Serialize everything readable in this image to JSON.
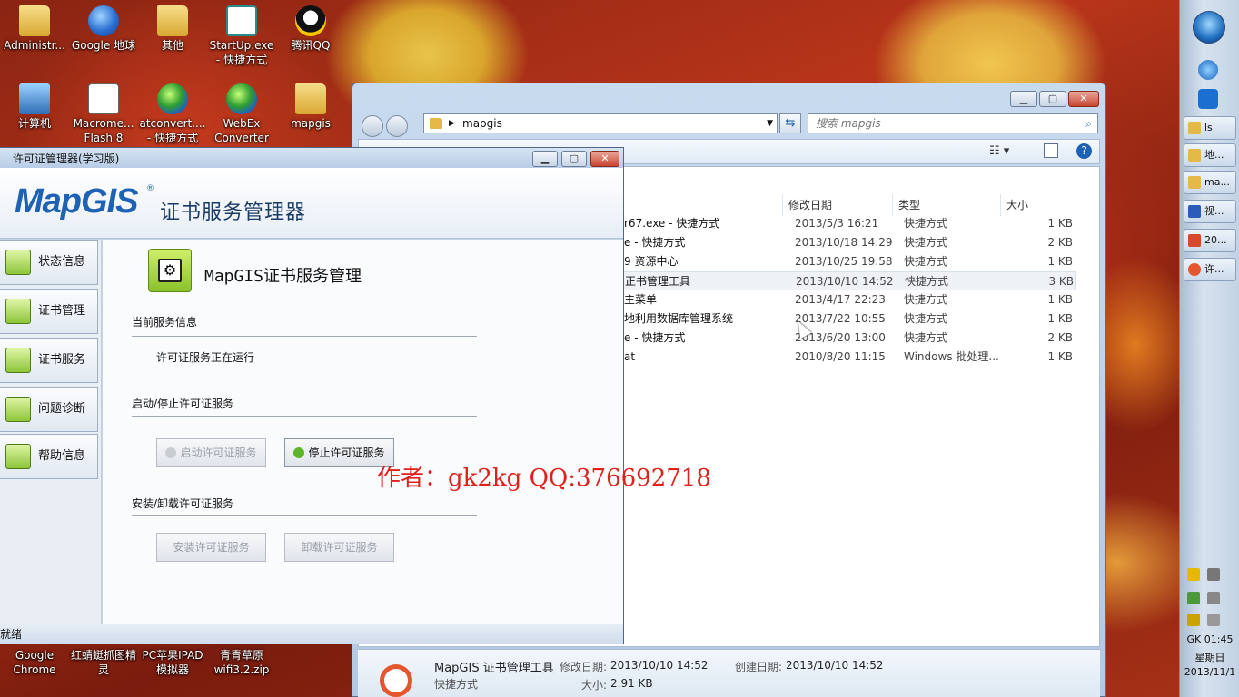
{
  "desktop": {
    "icons": [
      {
        "label": "Administr...",
        "icon": "folder-icon"
      },
      {
        "label": "Google 地球",
        "icon": "google-earth-icon"
      },
      {
        "label": "其他",
        "icon": "folder-icon"
      },
      {
        "label": "StartUp.exe - 快捷方式",
        "icon": "startup-icon"
      },
      {
        "label": "腾讯QQ",
        "icon": "qq-icon"
      },
      {
        "label": "计算机",
        "icon": "computer-icon"
      },
      {
        "label": "Macrome... Flash 8",
        "icon": "flash-doc-icon"
      },
      {
        "label": "atconvert.... - 快捷方式",
        "icon": "globe-icon"
      },
      {
        "label": "WebEx Converter",
        "icon": "globe-icon"
      },
      {
        "label": "mapgis",
        "icon": "folder-icon"
      },
      {
        "label": "Google Chrome",
        "icon": "chrome-icon"
      },
      {
        "label": "红蜻蜓抓图精灵",
        "icon": "dragonfly-icon"
      },
      {
        "label": "PC苹果IPAD 模拟器",
        "icon": "ipad-icon"
      },
      {
        "label": "青青草原 wifi3.2.zip",
        "icon": "zip-icon"
      }
    ]
  },
  "taskbar": {
    "buttons": [
      {
        "label": "ls",
        "icon": "folder-icon"
      },
      {
        "label": "地...",
        "icon": "folder-icon"
      },
      {
        "label": "ma...",
        "icon": "folder-icon"
      },
      {
        "label": "视...",
        "icon": "word-icon"
      },
      {
        "label": "20...",
        "icon": "calendar-icon"
      },
      {
        "label": "许...",
        "icon": "mapgis-icon"
      }
    ],
    "clock": {
      "time": "GK 01:45",
      "day": "星期日",
      "date": "2013/11/1"
    }
  },
  "explorer": {
    "address": "mapgis",
    "search_placeholder": "搜索 mapgis",
    "columns": {
      "date": "修改日期",
      "type": "类型",
      "size": "大小"
    },
    "files": [
      {
        "name": "r67.exe - 快捷方式",
        "date": "2013/5/3 16:21",
        "type": "快捷方式",
        "size": "1 KB"
      },
      {
        "name": "e - 快捷方式",
        "date": "2013/10/18 14:29",
        "type": "快捷方式",
        "size": "2 KB"
      },
      {
        "name": "9 资源中心",
        "date": "2013/10/25 19:58",
        "type": "快捷方式",
        "size": "1 KB"
      },
      {
        "name": "正书管理工具",
        "date": "2013/10/10 14:52",
        "type": "快捷方式",
        "size": "3 KB"
      },
      {
        "name": "主菜单",
        "date": "2013/4/17 22:23",
        "type": "快捷方式",
        "size": "1 KB"
      },
      {
        "name": "地利用数据库管理系统",
        "date": "2013/7/22 10:55",
        "type": "快捷方式",
        "size": "1 KB"
      },
      {
        "name": "e - 快捷方式",
        "date": "2013/6/20 13:00",
        "type": "快捷方式",
        "size": "2 KB"
      },
      {
        "name": "at",
        "date": "2010/8/20 11:15",
        "type": "Windows 批处理...",
        "size": "1 KB"
      }
    ],
    "selected_index": 3,
    "details": {
      "name": "MapGIS 证书管理工具",
      "kind": "快捷方式",
      "modified_label": "修改日期:",
      "modified": "2013/10/10 14:52",
      "created_label": "创建日期:",
      "created": "2013/10/10 14:52",
      "size_label": "大小:",
      "size": "2.91 KB"
    }
  },
  "license_manager": {
    "title": "许可证管理器(学习版)",
    "logo": "MapGIS",
    "banner_title": "证书服务管理器",
    "nav": [
      {
        "label": "状态信息",
        "icon": "status-info-icon"
      },
      {
        "label": "证书管理",
        "icon": "certificate-manage-icon"
      },
      {
        "label": "证书服务",
        "icon": "certificate-service-icon"
      },
      {
        "label": "问题诊断",
        "icon": "diagnosis-icon"
      },
      {
        "label": "帮助信息",
        "icon": "help-hand-icon"
      }
    ],
    "heading": "MapGIS证书服务管理",
    "current_service_label": "当前服务信息",
    "service_status": "许可证服务正在运行",
    "start_stop_label": "启动/停止许可证服务",
    "start_button": "启动许可证服务",
    "stop_button": "停止许可证服务",
    "install_label": "安装/卸载许可证服务",
    "install_button": "安装许可证服务",
    "uninstall_button": "卸载许可证服务",
    "status_bar": "就绪"
  },
  "watermark": "作者：gk2kg  QQ:376692718"
}
